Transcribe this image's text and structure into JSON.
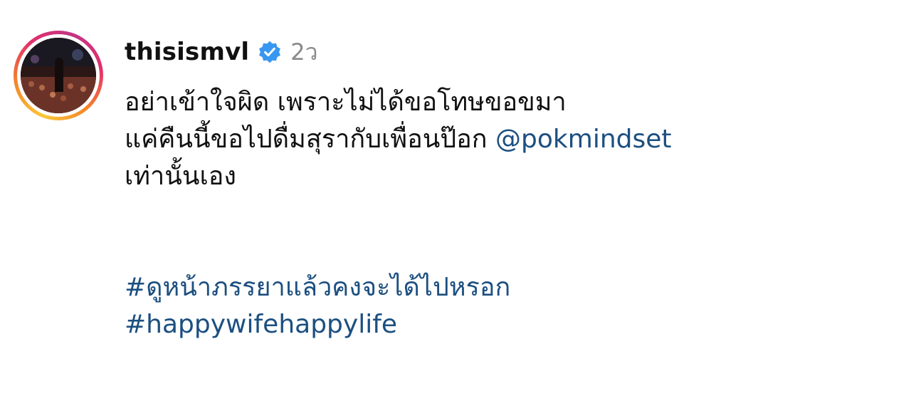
{
  "post": {
    "username": "thisismvl",
    "verified_icon": "verified-badge-icon",
    "time": "2ว",
    "caption_line1": "อย่าเข้าใจผิด เพราะไม่ได้ขอโทษขอขมา",
    "caption_line2": "แค่คืนนี้ขอไปดื่มสุรากับเพื่อนป๊อก",
    "mention": "@pokmindset",
    "caption_line3": "เท่านั้นเอง",
    "hashtag1": "#ดูหน้าภรรยาแล้วคงจะได้ไปหรอก",
    "hashtag2": "#happywifehappylife"
  },
  "colors": {
    "link": "#1c4f80",
    "verified": "#3897f0",
    "muted": "#8a8a8a",
    "text": "#111111"
  }
}
